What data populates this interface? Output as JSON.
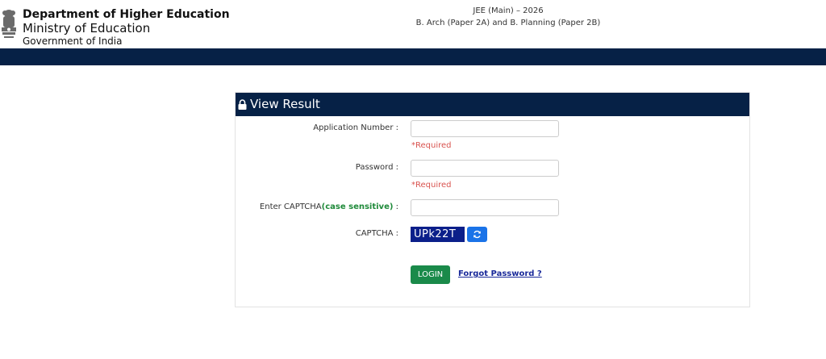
{
  "header": {
    "department": "Department of Higher Education",
    "ministry": "Ministry of Education",
    "government": "Government of India",
    "exam_title": "JEE (Main) – 2026",
    "exam_subtitle": "B. Arch (Paper 2A) and B. Planning (Paper 2B)"
  },
  "panel": {
    "title": "View Result",
    "application_label": "Application Number :",
    "application_value": "",
    "application_required": "*Required",
    "password_label": "Password :",
    "password_value": "",
    "password_required": "*Required",
    "captcha_input_label_prefix": "Enter CAPTCHA",
    "captcha_input_label_emphasis": "(case sensitive)",
    "captcha_input_label_suffix": " :",
    "captcha_input_value": "",
    "captcha_label": "CAPTCHA :",
    "captcha_text": "UPk22T",
    "login_label": "LOGIN",
    "forgot_label": "Forgot Password ?"
  },
  "colors": {
    "navy": "#062146",
    "required": "#d9534f",
    "login": "#1a8a4a",
    "refresh": "#1a73e8",
    "captcha_bg": "#0b1f8a",
    "link": "#1a2a9a",
    "case_sensitive": "#1f8a3a"
  },
  "icons": {
    "emblem": "national-emblem-icon",
    "lock": "lock-icon",
    "refresh": "refresh-icon"
  }
}
